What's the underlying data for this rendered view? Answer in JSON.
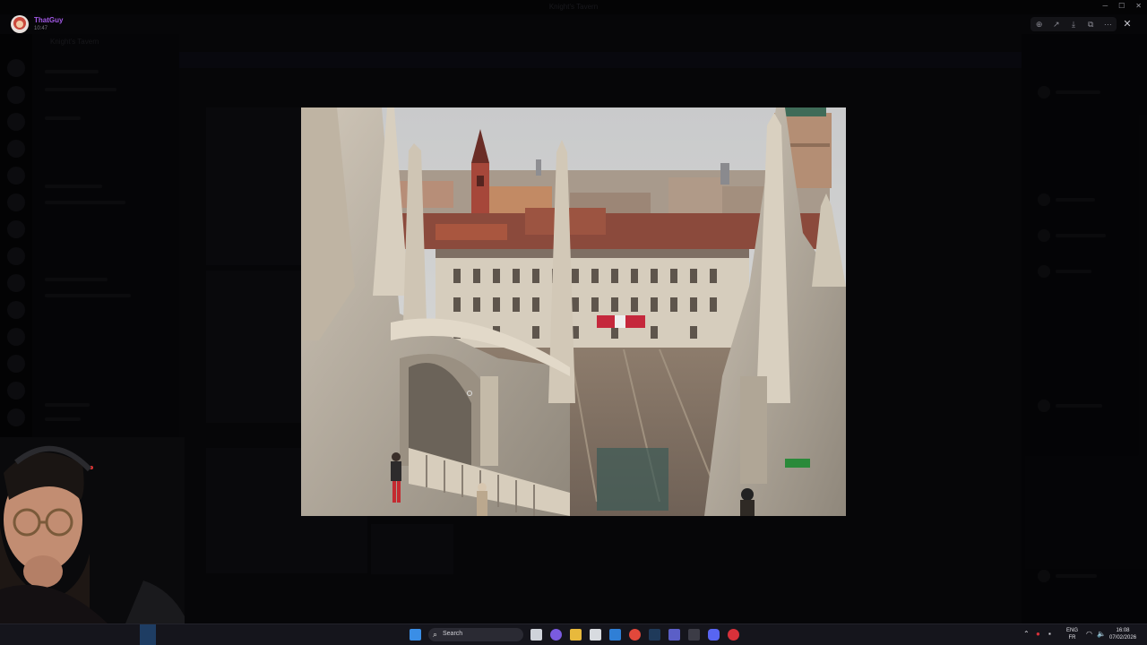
{
  "window": {
    "title": "Knight's Tavern",
    "controls": {
      "minimize": "─",
      "maximize": "☐",
      "close": "✕"
    }
  },
  "background_app": {
    "server_name": "Knight's Tavern",
    "channel_header": "#general"
  },
  "viewer": {
    "author": "ThatGuy",
    "time": "10:47",
    "toolbar": [
      {
        "name": "zoom-icon",
        "glyph": "⊕"
      },
      {
        "name": "share-icon",
        "glyph": "↗"
      },
      {
        "name": "download-icon",
        "glyph": "⤓"
      },
      {
        "name": "open-external-icon",
        "glyph": "⧉"
      },
      {
        "name": "more-options-icon",
        "glyph": "⋯"
      }
    ],
    "close_glyph": "✕",
    "image_subject": "Milan Cathedral rooftop spires overlooking Palazzo Reale courtyard"
  },
  "taskbar": {
    "search_label": "Search",
    "search_glyph": "⌕",
    "apps": [
      {
        "name": "start-icon",
        "color": "#3a8ee6"
      },
      {
        "name": "task-view-icon",
        "color": "#cfd3da"
      },
      {
        "name": "copilot-icon",
        "color": "#7a5be0"
      },
      {
        "name": "file-explorer-icon",
        "color": "#e8b93c"
      },
      {
        "name": "calendar-icon",
        "color": "#d8dbe0"
      },
      {
        "name": "mail-icon",
        "color": "#2f7fd6"
      },
      {
        "name": "chrome-icon",
        "color": "#e2483b"
      },
      {
        "name": "steam-icon",
        "color": "#1f3a5a"
      },
      {
        "name": "teams-icon",
        "color": "#5b5fc7"
      },
      {
        "name": "obs-icon",
        "color": "#3c3c46"
      },
      {
        "name": "discord-icon",
        "color": "#5865f2"
      },
      {
        "name": "opera-icon",
        "color": "#d8313a"
      }
    ],
    "tray": {
      "chevron": "⌃",
      "lang_top": "ENG",
      "lang_bottom": "FR",
      "wifi": "◠",
      "volume": "🔈",
      "time": "16:08",
      "date": "07/02/2026"
    }
  }
}
